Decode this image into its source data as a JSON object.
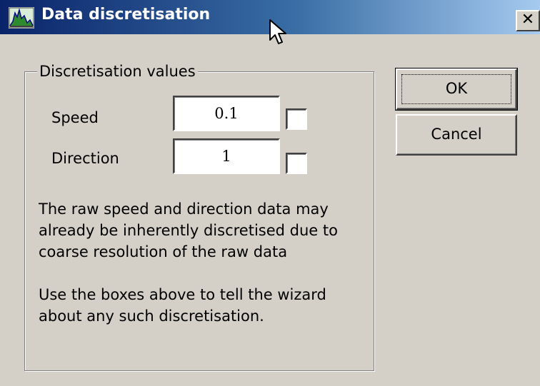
{
  "window": {
    "title": "Data discretisation",
    "close_glyph": "✕",
    "title_icon": "chart-app-icon",
    "cursor_icon": "mouse-pointer-icon"
  },
  "group": {
    "legend": "Discretisation values",
    "speed": {
      "label": "Speed",
      "value": "0.1",
      "checked": false
    },
    "direction": {
      "label": "Direction",
      "value": "1",
      "checked": false
    },
    "paragraph1": "The raw speed and direction data may already be inherently discretised due to coarse resolution of the raw data",
    "paragraph2": "Use the boxes above to tell the wizard about any such discretisation."
  },
  "buttons": {
    "ok": "OK",
    "cancel": "Cancel"
  },
  "colors": {
    "titlebar_start": "#0a246a",
    "titlebar_end": "#a6caf0",
    "face": "#d4d0c8"
  }
}
